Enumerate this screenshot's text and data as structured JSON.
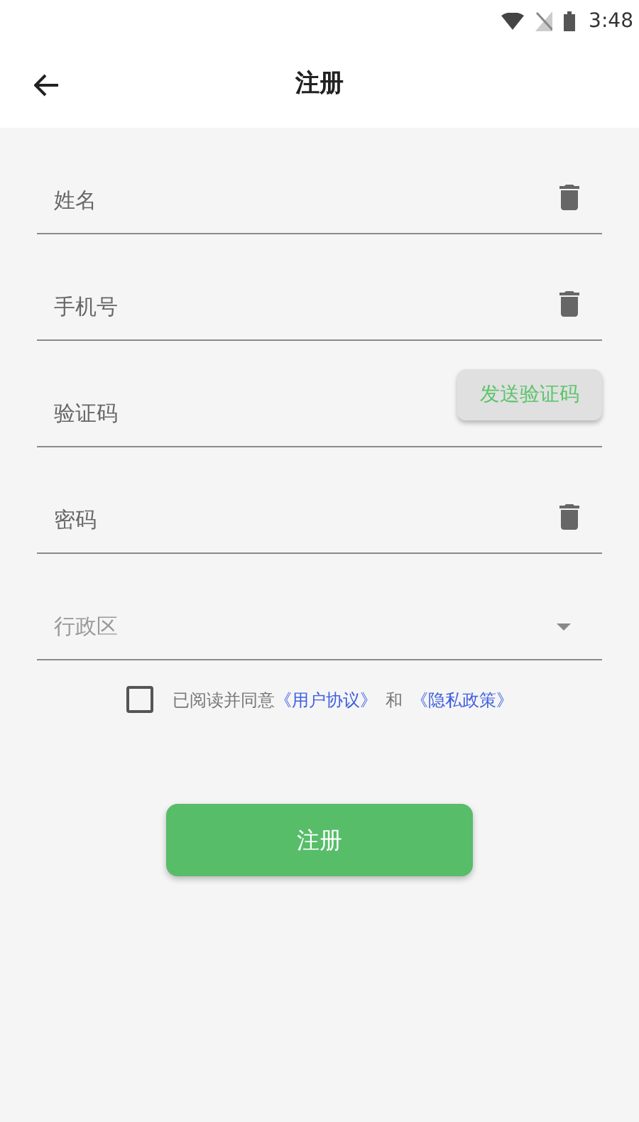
{
  "status_bar": {
    "time": "3:48"
  },
  "app_bar": {
    "title": "注册"
  },
  "fields": [
    {
      "kind": "clear",
      "placeholder": "姓名"
    },
    {
      "kind": "clear",
      "placeholder": "手机号"
    },
    {
      "kind": "code",
      "placeholder": "验证码",
      "button": "发送验证码"
    },
    {
      "kind": "clear",
      "placeholder": "密码"
    },
    {
      "kind": "dropdown",
      "placeholder": "行政区"
    }
  ],
  "agreement": {
    "checked": false,
    "text": "已阅读并同意",
    "link_1": "《用户协议》",
    "and": "和",
    "link_2": "《隐私政策》"
  },
  "submit": "注册"
}
